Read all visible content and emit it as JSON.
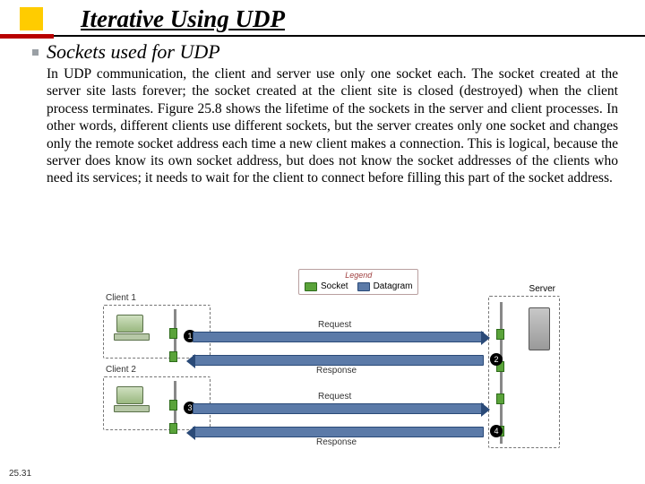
{
  "title": "Iterative Using UDP",
  "subtitle": "Sockets used for UDP",
  "body": "In UDP communication, the client and server use only one socket each. The socket created at the server site lasts forever; the socket created at the client site is closed (destroyed) when the client process terminates. Figure 25.8 shows the lifetime of the sockets in the server and client processes. In other words, different clients use different sockets, but the server creates only one socket and changes only the remote socket address each time a new client makes a connection. This is logical, because the server does know its own socket address, but does not know the socket addresses of the clients who need its services; it needs to wait for the client to connect before filling this part of the socket address.",
  "slide_number": "25.31",
  "diagram": {
    "legend_title": "Legend",
    "legend_socket": "Socket",
    "legend_datagram": "Datagram",
    "client1": "Client 1",
    "client2": "Client 2",
    "server": "Server",
    "request": "Request",
    "response": "Response",
    "n1": "1",
    "n2": "2",
    "n3": "3",
    "n4": "4"
  }
}
